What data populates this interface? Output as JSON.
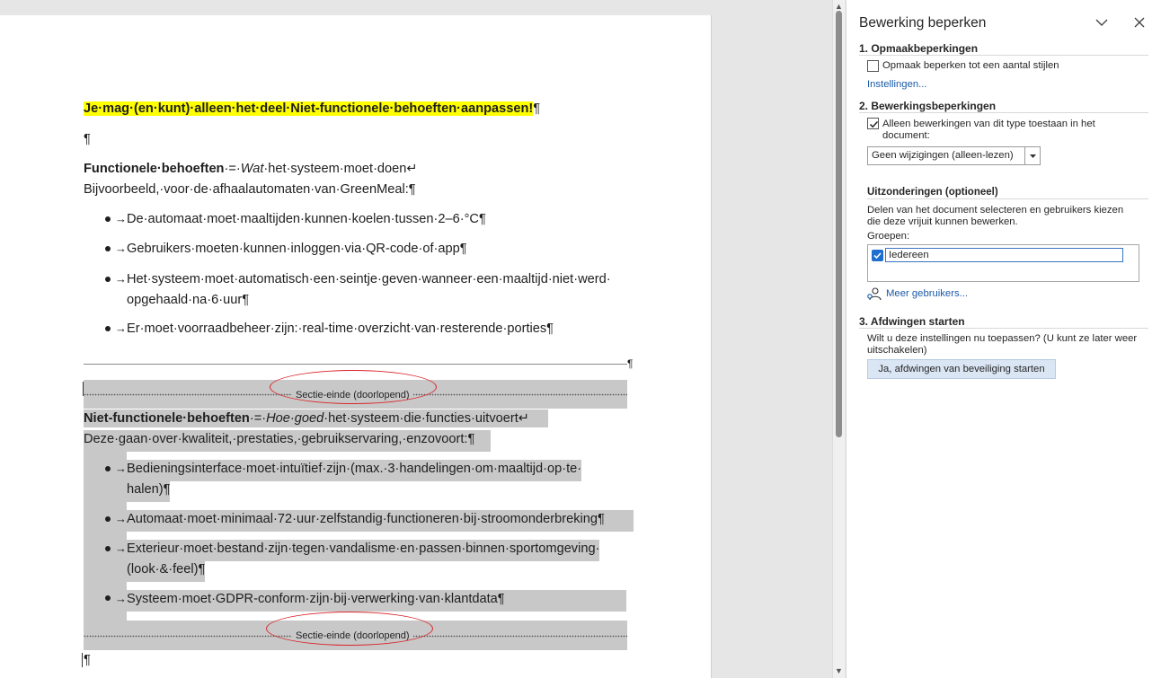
{
  "document": {
    "line1": "Je·mag·(en·kunt)·alleen·het·deel·Niet-functionele·behoeften·aanpassen!",
    "pilcrow": "¶",
    "func_head_bold": "Functionele·behoeften",
    "func_head_rest1": "·=·",
    "func_head_ital": "Wat",
    "func_head_rest2": "·het·systeem·moet·doen↵",
    "func_example": "Bijvoorbeeld,·voor·de·afhaalautomaten·van·GreenMeal:¶",
    "func_bullets": [
      "De·automaat·moet·maaltijden·kunnen·koelen·tussen·2–6·°C¶",
      "Gebruikers·moeten·kunnen·inloggen·via·QR-code·of·app¶",
      "Het·systeem·moet·automatisch·een·seintje·geven·wanneer·een·maaltijd·niet·werd·",
      "opgehaald·na·6·uur¶",
      "Er·moet·voorraadbeheer·zijn:·real-time·overzicht·van·resterende·porties¶"
    ],
    "bullet_arrow": "→",
    "section_break_label": "Sectie-einde (doorlopend)",
    "nf_head_bold": "Niet-functionele·behoeften",
    "nf_head_rest1": "·=·",
    "nf_head_ital": "Hoe·goed",
    "nf_head_rest2": "·het·systeem·die·functies·uitvoert↵",
    "nf_intro": "Deze·gaan·over·kwaliteit,·prestaties,·gebruikservaring,·enzovoort:¶",
    "nf_bullets": [
      "Bedieningsinterface·moet·intuïtief·zijn·(max.·3·handelingen·om·maaltijd·op·te·",
      "halen)¶",
      "Automaat·moet·minimaal·72·uur·zelfstandig·functioneren·bij·stroomonderbreking¶",
      "Exterieur·moet·bestand·zijn·tegen·vandalisme·en·passen·binnen·sportomgeving·",
      "(look·&·feel)¶",
      "Systeem·moet·GDPR-conform·zijn·bij·verwerking·van·klantdata¶"
    ]
  },
  "pane": {
    "title": "Bewerking beperken",
    "section1": {
      "heading": "1. Opmaakbeperkingen",
      "checkbox_label": "Opmaak beperken tot een aantal stijlen",
      "checked": false,
      "settings_link": "Instellingen..."
    },
    "section2": {
      "heading": "2. Bewerkingsbeperkingen",
      "checkbox_label_line1": "Alleen bewerkingen van dit type toestaan in het",
      "checkbox_label_line2": "document:",
      "checked": true,
      "mode_value": "Geen wijzigingen (alleen-lezen)",
      "exceptions_heading": "Uitzonderingen (optioneel)",
      "exceptions_desc_line1": "Delen van het document selecteren en gebruikers kiezen",
      "exceptions_desc_line2": "die deze vrijuit kunnen bewerken.",
      "groups_label": "Groepen:",
      "group_item": "Iedereen",
      "more_users_link": "Meer gebruikers..."
    },
    "section3": {
      "heading": "3. Afdwingen starten",
      "desc_line1": "Wilt u deze instellingen nu toepassen? (U kunt ze later weer",
      "desc_line2": "uitschakelen)",
      "button_label": "Ja, afdwingen van beveiliging starten"
    }
  },
  "colors": {
    "highlight": "#ffff00",
    "shading": "#c8c8c8",
    "annotation": "#d9262b",
    "link": "#1b5aa8",
    "checkbox_accent": "#1f6fd0"
  }
}
